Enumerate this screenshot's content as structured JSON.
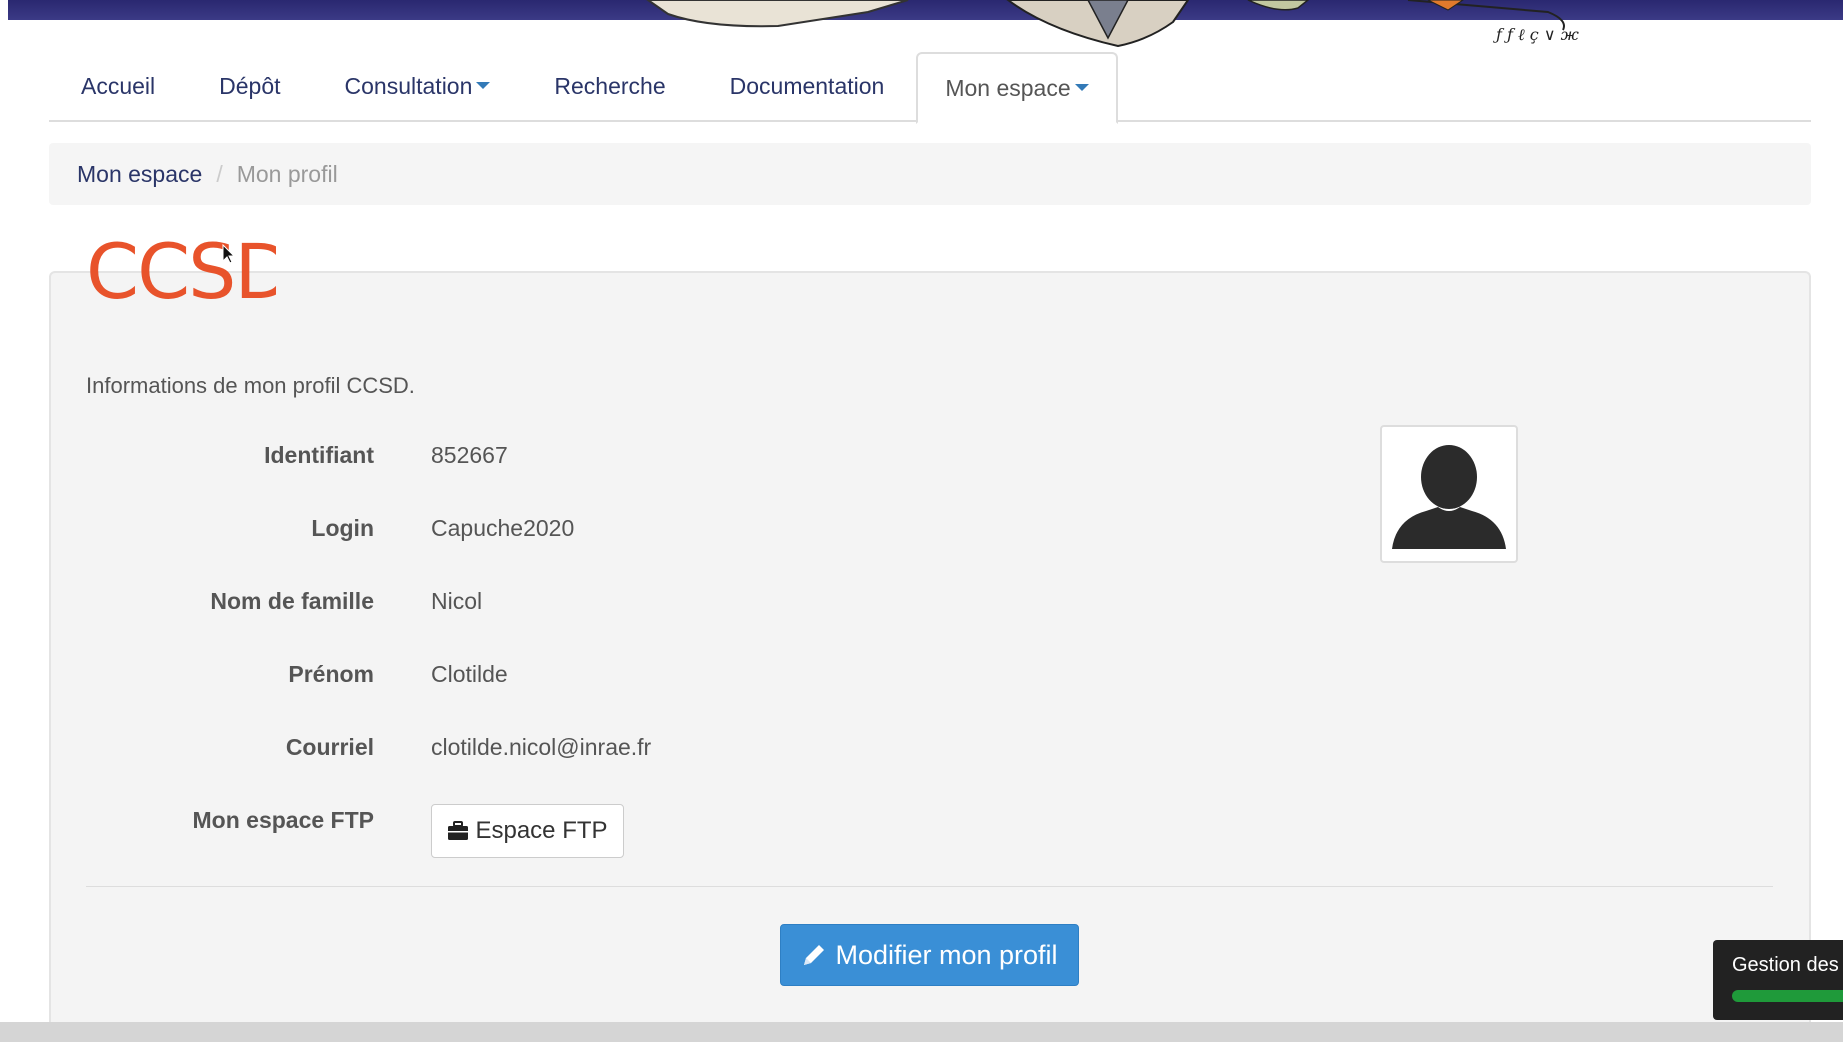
{
  "nav": {
    "items": [
      {
        "label": "Accueil",
        "dropdown": false,
        "active": false
      },
      {
        "label": "Dépôt",
        "dropdown": false,
        "active": false
      },
      {
        "label": "Consultation",
        "dropdown": true,
        "active": false
      },
      {
        "label": "Recherche",
        "dropdown": false,
        "active": false
      },
      {
        "label": "Documentation",
        "dropdown": false,
        "active": false
      },
      {
        "label": "Mon espace",
        "dropdown": true,
        "active": true
      }
    ]
  },
  "breadcrumb": {
    "parent": "Mon espace",
    "separator": "/",
    "current": "Mon profil"
  },
  "profile": {
    "logo_text": "CCSD",
    "intro": "Informations de mon profil CCSD.",
    "fields": [
      {
        "label": "Identifiant",
        "value": "852667"
      },
      {
        "label": "Login",
        "value": "Capuche2020"
      },
      {
        "label": "Nom de famille",
        "value": "Nicol"
      },
      {
        "label": "Prénom",
        "value": "Clotilde"
      },
      {
        "label": "Courriel",
        "value": "clotilde.nicol@inrae.fr"
      }
    ],
    "ftp_label": "Mon espace FTP",
    "ftp_button": "Espace FTP",
    "ftp_icon": "briefcase-icon",
    "edit_button": "Modifier mon profil",
    "edit_icon": "pencil-icon",
    "avatar_icon": "user-silhouette-icon"
  },
  "cookie_widget": {
    "text": "Gestion des"
  },
  "colors": {
    "link": "#2a3568",
    "primary_button": "#3a8fd6",
    "logo": "#e8532b",
    "banner": "#2a2870",
    "cookie_bar": "#1f9a3a"
  }
}
